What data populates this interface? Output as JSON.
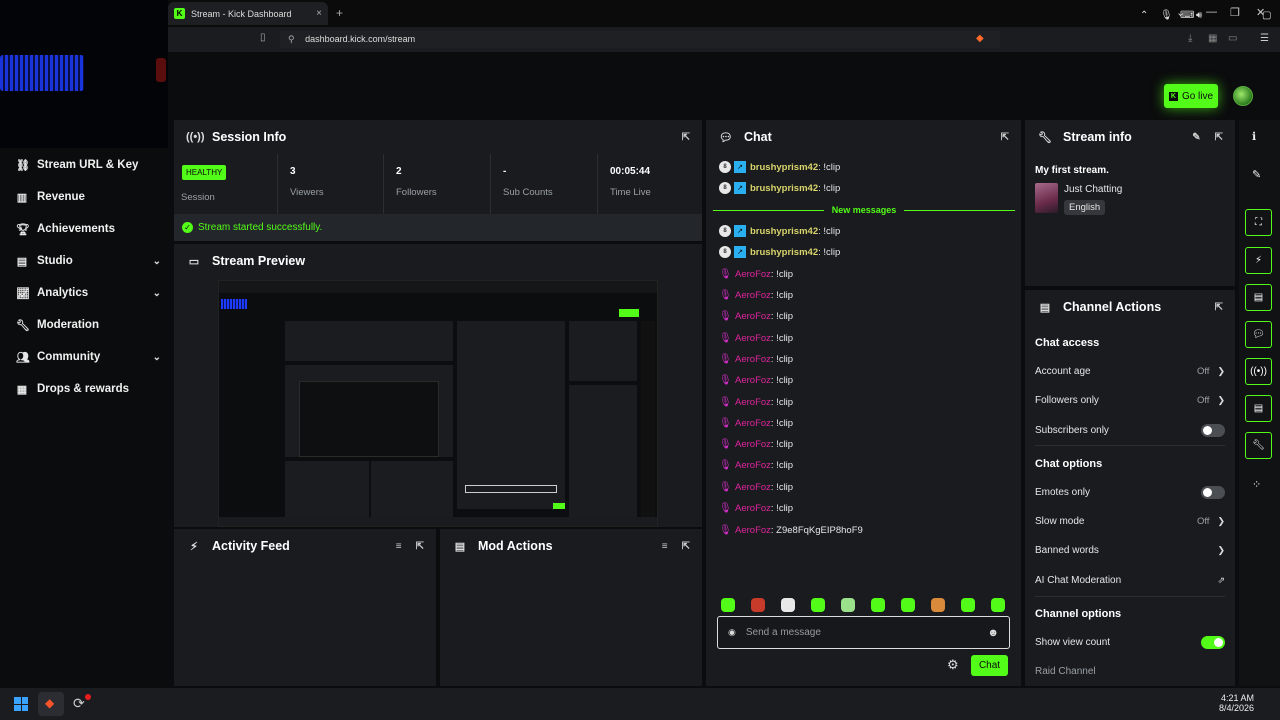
{
  "browser": {
    "tab_title": "Stream - Kick Dashboard",
    "tab_favicon": "K",
    "url": "dashboard.kick.com/stream",
    "new_tab": "+",
    "close_tab": "×"
  },
  "sidebar": {
    "items": [
      {
        "label": "Stream URL & Key",
        "icon": "link-icon"
      },
      {
        "label": "Revenue",
        "icon": "chart-icon"
      },
      {
        "label": "Achievements",
        "icon": "trophy-icon"
      },
      {
        "label": "Studio",
        "icon": "studio-icon",
        "expandable": true
      },
      {
        "label": "Analytics",
        "icon": "analytics-icon",
        "expandable": true
      },
      {
        "label": "Moderation",
        "icon": "wrench-icon"
      },
      {
        "label": "Community",
        "icon": "people-icon",
        "expandable": true
      },
      {
        "label": "Drops & rewards",
        "icon": "gift-icon"
      }
    ]
  },
  "header": {
    "go_live": "Go live"
  },
  "session": {
    "title": "Session Info",
    "health": "HEALTHY",
    "stats": [
      {
        "value": "",
        "label": "Session"
      },
      {
        "value": "3",
        "label": "Viewers"
      },
      {
        "value": "2",
        "label": "Followers"
      },
      {
        "value": "-",
        "label": "Sub Counts"
      },
      {
        "value": "00:05:44",
        "label": "Time Live"
      }
    ],
    "message": "Stream started successfully."
  },
  "preview": {
    "title": "Stream Preview"
  },
  "activity": {
    "title": "Activity Feed"
  },
  "mod_actions": {
    "title": "Mod Actions"
  },
  "chat": {
    "title": "Chat",
    "new_messages": "New messages",
    "messages_before": [
      {
        "user": "brushyprism42",
        "text": ": !clip"
      },
      {
        "user": "brushyprism42",
        "text": ": !clip"
      }
    ],
    "messages_after": [
      {
        "user": "brushyprism42",
        "text": ": !clip",
        "kind": "sub"
      },
      {
        "user": "brushyprism42",
        "text": ": !clip",
        "kind": "sub"
      },
      {
        "user": "AeroFoz",
        "text": ": !clip",
        "kind": "mic"
      },
      {
        "user": "AeroFoz",
        "text": ": !clip",
        "kind": "mic"
      },
      {
        "user": "AeroFoz",
        "text": ": !clip",
        "kind": "mic"
      },
      {
        "user": "AeroFoz",
        "text": ": !clip",
        "kind": "mic"
      },
      {
        "user": "AeroFoz",
        "text": ": !clip",
        "kind": "mic"
      },
      {
        "user": "AeroFoz",
        "text": ": !clip",
        "kind": "mic"
      },
      {
        "user": "AeroFoz",
        "text": ": !clip",
        "kind": "mic"
      },
      {
        "user": "AeroFoz",
        "text": ": !clip",
        "kind": "mic"
      },
      {
        "user": "AeroFoz",
        "text": ": !clip",
        "kind": "mic"
      },
      {
        "user": "AeroFoz",
        "text": ": !clip",
        "kind": "mic"
      },
      {
        "user": "AeroFoz",
        "text": ": !clip",
        "kind": "mic"
      },
      {
        "user": "AeroFoz",
        "text": ": !clip",
        "kind": "mic"
      },
      {
        "user": "AeroFoz",
        "text": ": Z9e8FqKgEIP8hoF9",
        "kind": "mic"
      }
    ],
    "input_placeholder": "Send a message",
    "send_label": "Chat"
  },
  "stream_info": {
    "title": "Stream info",
    "stream_title": "My first stream.",
    "category": "Just Chatting",
    "language": "English"
  },
  "channel_actions": {
    "title": "Channel Actions",
    "chat_access": "Chat access",
    "account_age": "Account age",
    "account_age_val": "Off",
    "followers_only": "Followers only",
    "followers_only_val": "Off",
    "subscribers_only": "Subscribers only",
    "chat_options": "Chat options",
    "emotes_only": "Emotes only",
    "slow_mode": "Slow mode",
    "slow_mode_val": "Off",
    "banned_words": "Banned words",
    "ai_moderation": "AI Chat Moderation",
    "channel_options": "Channel options",
    "show_view_count": "Show view count",
    "raid_channel": "Raid Channel"
  },
  "taskbar": {
    "time": "4:21 AM",
    "date": "8/4/2026"
  },
  "colors": {
    "accent": "#53fc18",
    "panel": "#191b1f",
    "bg": "#0b0c0d"
  }
}
